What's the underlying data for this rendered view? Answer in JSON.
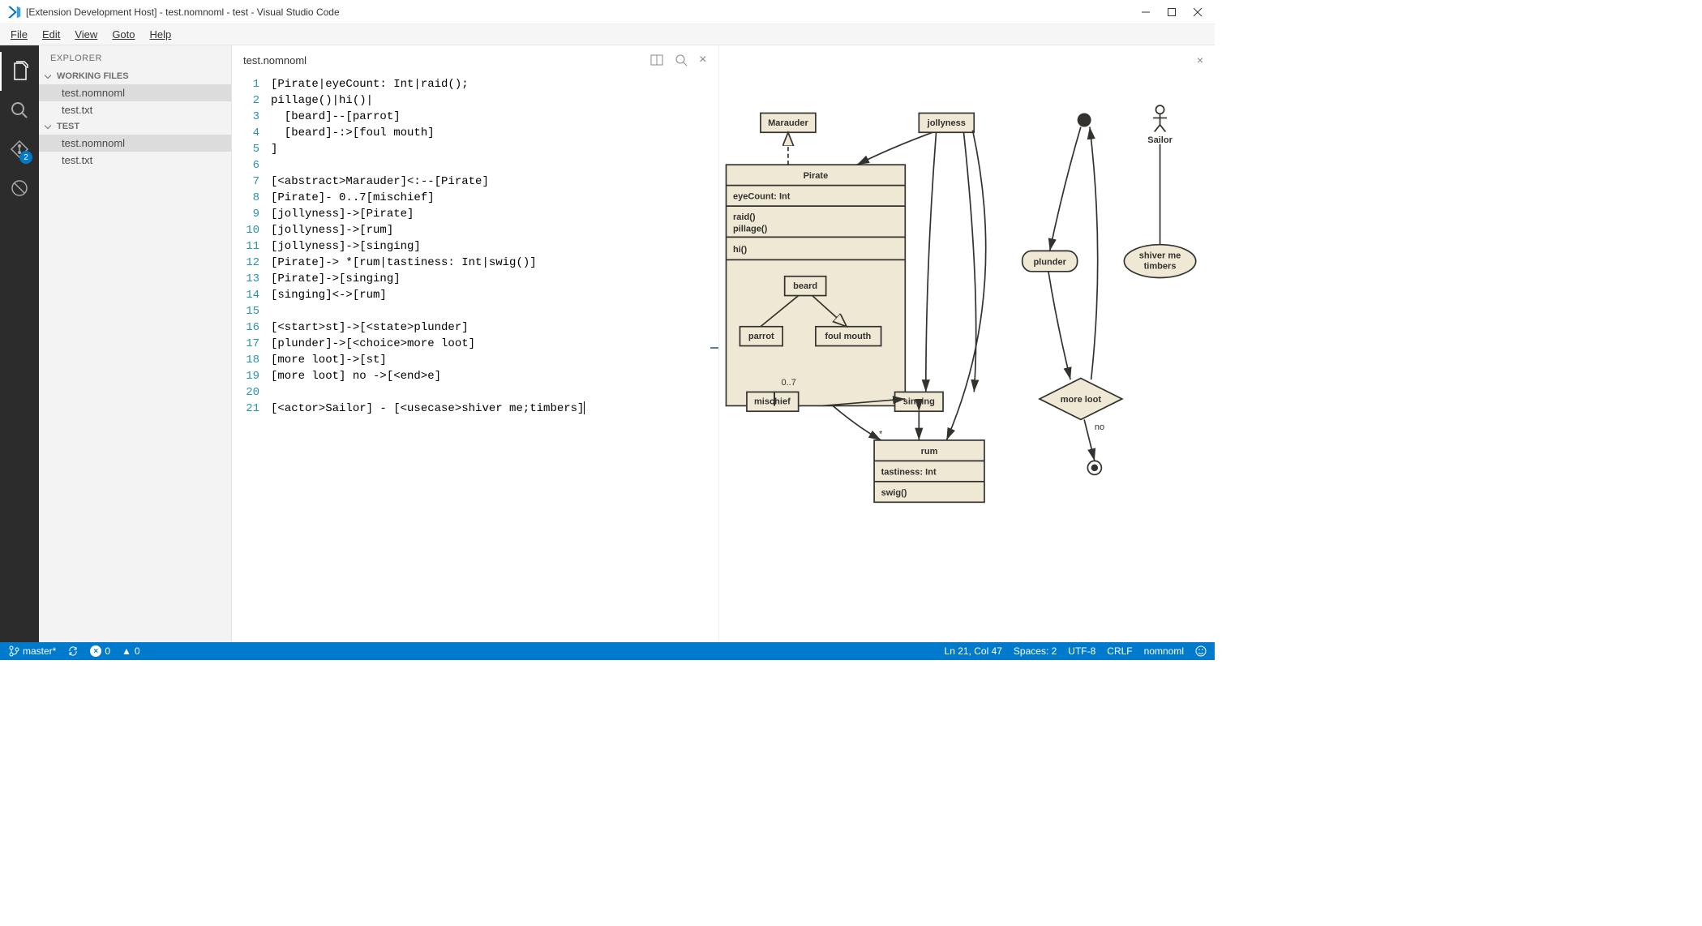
{
  "window": {
    "title": "[Extension Development Host] - test.nomnoml - test - Visual Studio Code"
  },
  "menu": {
    "file": "File",
    "edit": "Edit",
    "view": "View",
    "goto": "Goto",
    "help": "Help"
  },
  "activity": {
    "badge": "2"
  },
  "sidebar": {
    "title": "EXPLORER",
    "working_label": "WORKING FILES",
    "working_files": [
      "test.nomnoml",
      "test.txt"
    ],
    "folder_label": "TEST",
    "folder_files": [
      "test.nomnoml",
      "test.txt"
    ]
  },
  "tab": {
    "name": "test.nomnoml"
  },
  "code": {
    "lines": [
      "[Pirate|eyeCount: Int|raid();",
      "pillage()|hi()|",
      "  [beard]--[parrot]",
      "  [beard]-:>[foul mouth]",
      "]",
      "",
      "[<abstract>Marauder]<:--[Pirate]",
      "[Pirate]- 0..7[mischief]",
      "[jollyness]->[Pirate]",
      "[jollyness]->[rum]",
      "[jollyness]->[singing]",
      "[Pirate]-> *[rum|tastiness: Int|swig()]",
      "[Pirate]->[singing]",
      "[singing]<->[rum]",
      "",
      "[<start>st]->[<state>plunder]",
      "[plunder]->[<choice>more loot]",
      "[more loot]->[st]",
      "[more loot] no ->[<end>e]",
      "",
      "[<actor>Sailor] - [<usecase>shiver me;timbers]"
    ]
  },
  "diagram": {
    "marauder": "Marauder",
    "jollyness": "jollyness",
    "sailor": "Sailor",
    "pirate": "Pirate",
    "eyecount": "eyeCount: Int",
    "raid": "raid()",
    "pillage": "pillage()",
    "hi": "hi()",
    "beard": "beard",
    "parrot": "parrot",
    "foulmouth": "foul mouth",
    "mischief": "mischief",
    "mischief_mult": "0..7",
    "singing": "singing",
    "rum": "rum",
    "tastiness": "tastiness: Int",
    "swig": "swig()",
    "rum_mult": "*",
    "plunder": "plunder",
    "moreloot": "more loot",
    "no": "no",
    "shiver1": "shiver me",
    "shiver2": "timbers"
  },
  "status": {
    "branch": "master*",
    "errors": "0",
    "warnings": "0",
    "ln_col": "Ln 21, Col 47",
    "spaces": "Spaces: 2",
    "encoding": "UTF-8",
    "eol": "CRLF",
    "lang": "nomnoml"
  }
}
